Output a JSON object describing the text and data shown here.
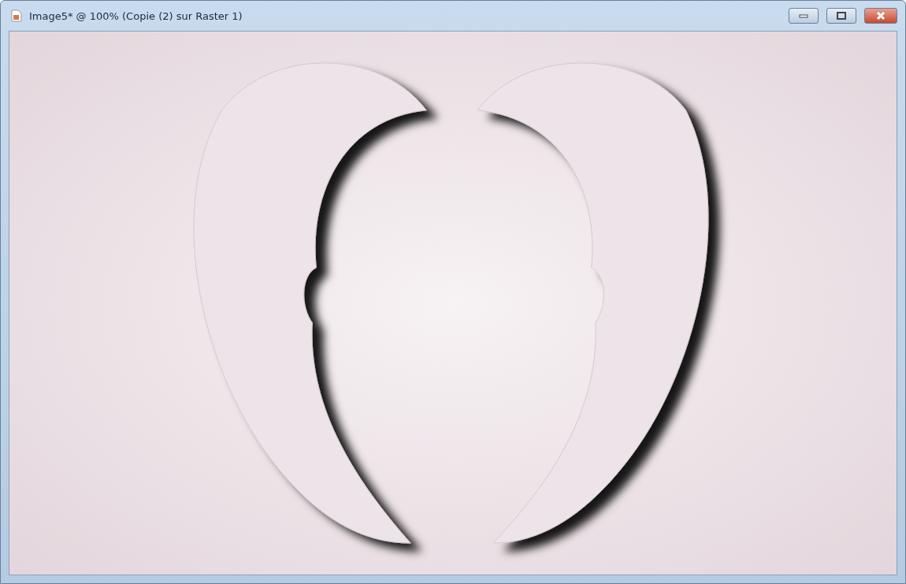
{
  "window": {
    "title": "Image5* @ 100% (Copie (2) sur Raster 1)"
  }
}
